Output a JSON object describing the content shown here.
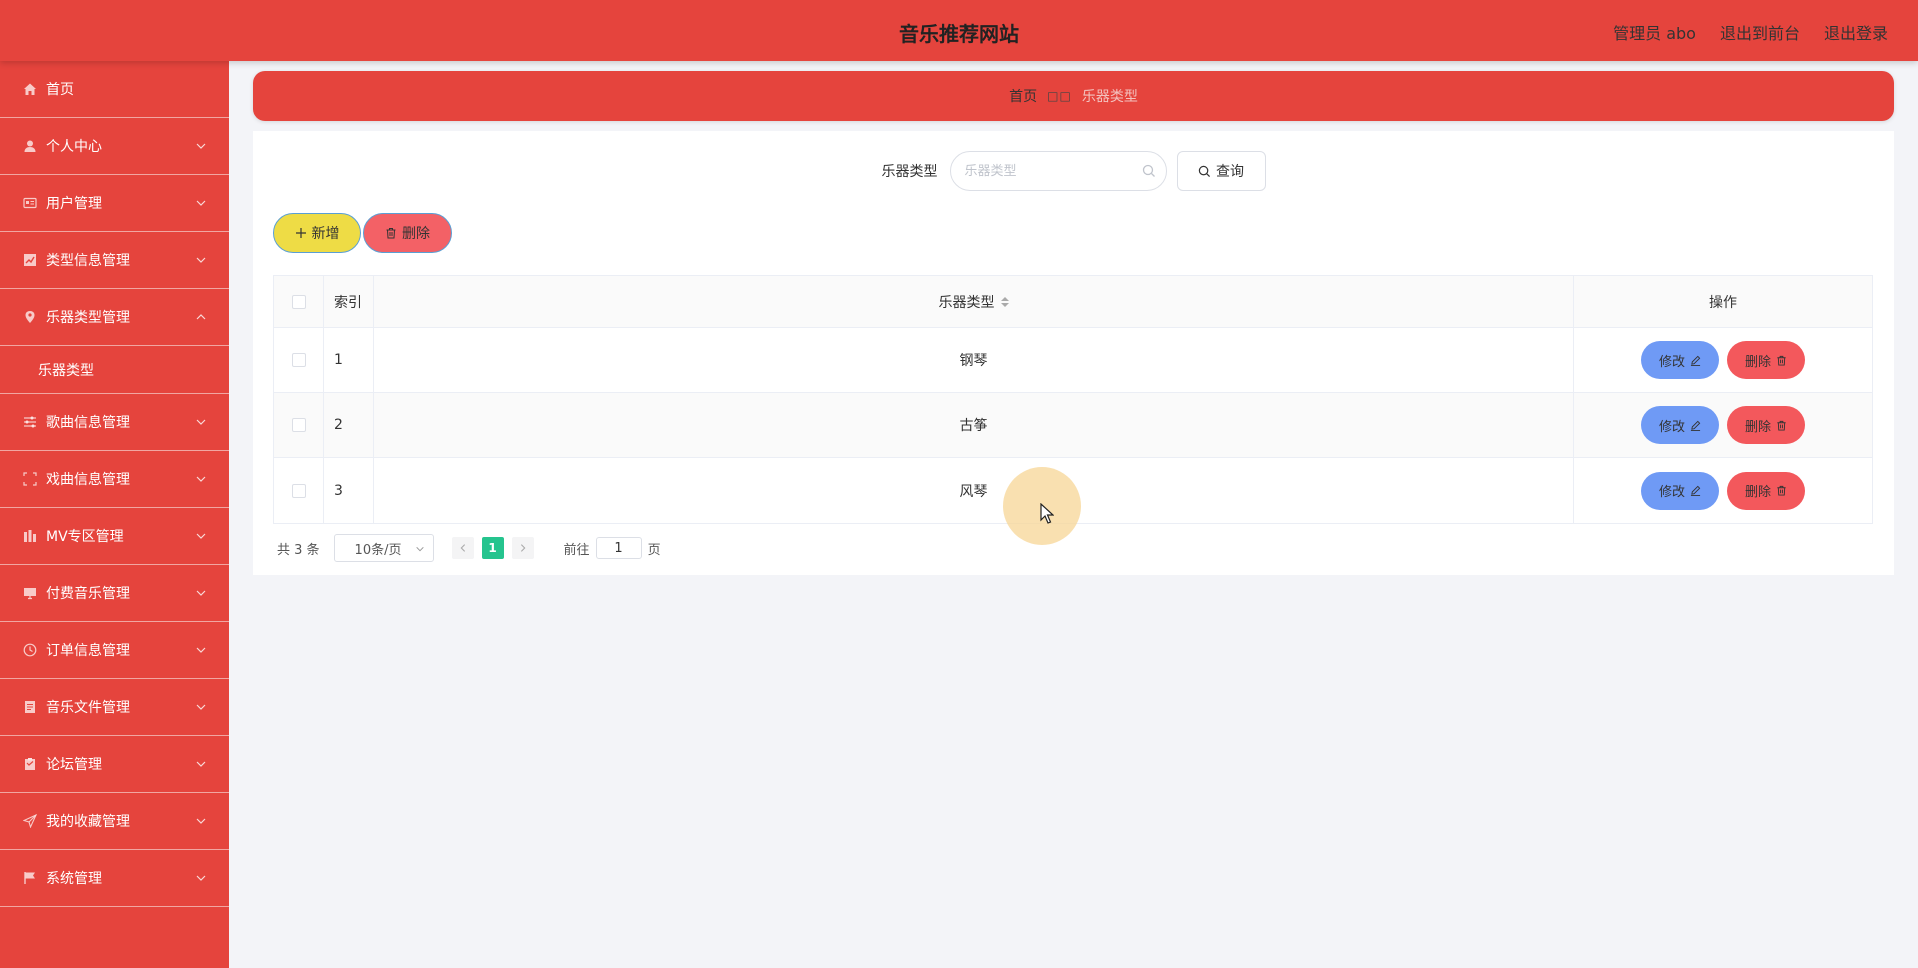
{
  "header": {
    "title": "音乐推荐网站",
    "user_label": "管理员 abo",
    "to_front_label": "退出到前台",
    "logout_label": "退出登录"
  },
  "sidebar": {
    "items": [
      {
        "label": "首页",
        "icon": "home-icon"
      },
      {
        "label": "个人中心",
        "icon": "user-icon"
      },
      {
        "label": "用户管理",
        "icon": "id-card-icon"
      },
      {
        "label": "类型信息管理",
        "icon": "chart-icon"
      },
      {
        "label": "乐器类型管理",
        "icon": "location-icon"
      },
      {
        "label": "乐器类型",
        "sub": true
      },
      {
        "label": "歌曲信息管理",
        "icon": "sliders-icon"
      },
      {
        "label": "戏曲信息管理",
        "icon": "fullscreen-icon"
      },
      {
        "label": "MV专区管理",
        "icon": "bar-chart-icon"
      },
      {
        "label": "付费音乐管理",
        "icon": "monitor-icon"
      },
      {
        "label": "订单信息管理",
        "icon": "clock-icon"
      },
      {
        "label": "音乐文件管理",
        "icon": "document-icon"
      },
      {
        "label": "论坛管理",
        "icon": "clipboard-icon"
      },
      {
        "label": "我的收藏管理",
        "icon": "send-icon"
      },
      {
        "label": "系统管理",
        "icon": "flag-icon"
      }
    ]
  },
  "breadcrumb": {
    "home": "首页",
    "separator": "□□",
    "current": "乐器类型"
  },
  "search": {
    "label": "乐器类型",
    "placeholder": "乐器类型",
    "button_label": "查询"
  },
  "actions": {
    "add_label": "新增",
    "delete_label": "删除"
  },
  "table": {
    "headers": {
      "index": "索引",
      "type": "乐器类型",
      "ops": "操作"
    },
    "rows": [
      {
        "index": "1",
        "type": "钢琴"
      },
      {
        "index": "2",
        "type": "古筝"
      },
      {
        "index": "3",
        "type": "风琴"
      }
    ],
    "edit_label": "修改",
    "delete_label": "删除"
  },
  "pagination": {
    "total": "共 3 条",
    "page_size": "10条/页",
    "current_page": "1",
    "goto_label": "前往",
    "goto_value": "1",
    "page_suffix": "页"
  },
  "colors": {
    "primary": "#e5443d",
    "add_button": "#eedc45",
    "delete_button": "#f36166",
    "edit_button": "#6f9af5",
    "active_page": "#25c48e"
  }
}
